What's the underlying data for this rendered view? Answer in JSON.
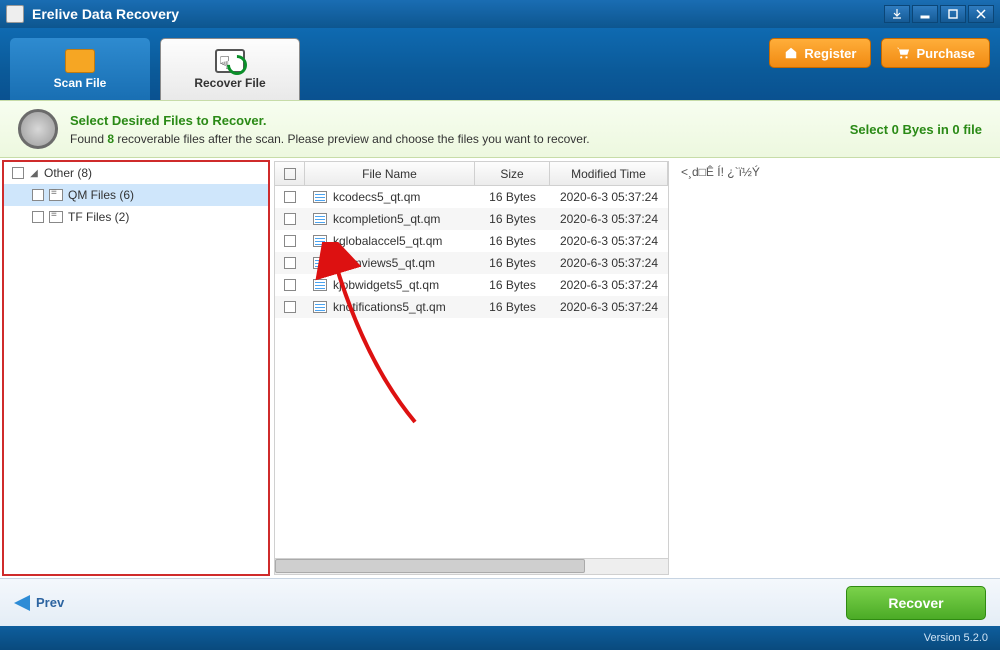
{
  "app": {
    "title": "Erelive Data Recovery"
  },
  "tabs": {
    "scan": {
      "label": "Scan File"
    },
    "recover": {
      "label": "Recover File"
    }
  },
  "header_buttons": {
    "register": "Register",
    "purchase": "Purchase"
  },
  "banner": {
    "title": "Select Desired Files to Recover.",
    "line_prefix": "Found ",
    "count": "8",
    "line_suffix": " recoverable files after the scan. Please preview and choose the files you want to recover.",
    "select_status": "Select 0 Byes in 0 file"
  },
  "sidebar": {
    "root": "Other (8)",
    "items": [
      {
        "label": "QM Files (6)",
        "selected": true
      },
      {
        "label": "TF Files (2)",
        "selected": false
      }
    ]
  },
  "table": {
    "headers": {
      "name": "File Name",
      "size": "Size",
      "time": "Modified Time"
    },
    "rows": [
      {
        "name": "kcodecs5_qt.qm",
        "size": "16 Bytes",
        "time": "2020-6-3 05:37:24"
      },
      {
        "name": "kcompletion5_qt.qm",
        "size": "16 Bytes",
        "time": "2020-6-3 05:37:24"
      },
      {
        "name": "kglobalaccel5_qt.qm",
        "size": "16 Bytes",
        "time": "2020-6-3 05:37:24"
      },
      {
        "name": "kitemviews5_qt.qm",
        "size": "16 Bytes",
        "time": "2020-6-3 05:37:24"
      },
      {
        "name": "kjobwidgets5_qt.qm",
        "size": "16 Bytes",
        "time": "2020-6-3 05:37:24"
      },
      {
        "name": "knotifications5_qt.qm",
        "size": "16 Bytes",
        "time": "2020-6-3 05:37:24"
      }
    ]
  },
  "preview": {
    "garbage": "<¸d□Ê    Í!   ¿`ï½Ý"
  },
  "footer": {
    "prev": "Prev",
    "recover": "Recover"
  },
  "status": {
    "version_label": "Version 5.2.0"
  }
}
